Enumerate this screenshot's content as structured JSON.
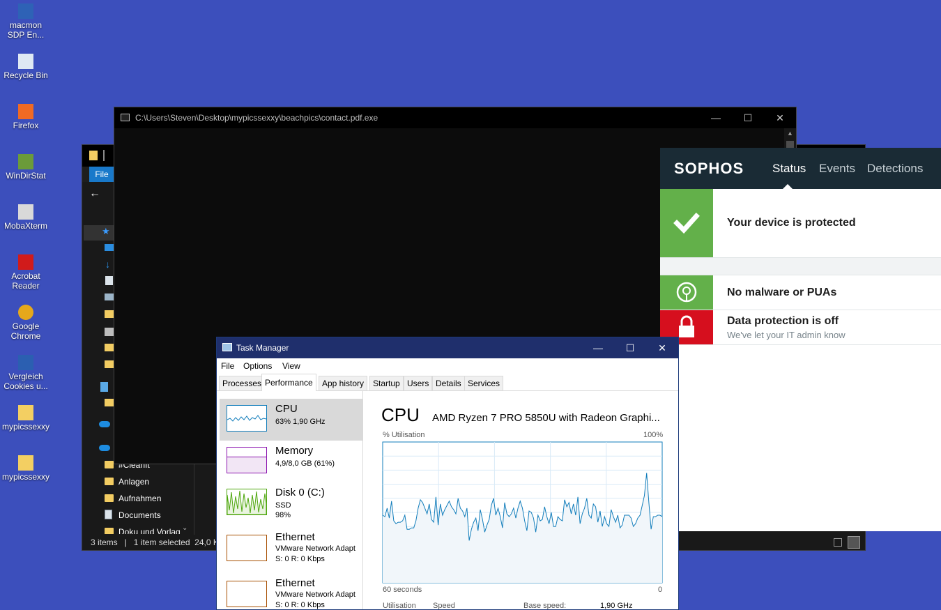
{
  "desktop_icons": [
    {
      "label": "macmon SDP En...",
      "icon": "macmon-icon"
    },
    {
      "label": "Recycle Bin",
      "icon": "recycle-bin-icon"
    },
    {
      "label": "Firefox",
      "icon": "firefox-icon"
    },
    {
      "label": "WinDirStat",
      "icon": "windirstat-icon"
    },
    {
      "label": "MobaXterm",
      "icon": "mobaxterm-icon"
    },
    {
      "label": "Acrobat Reader",
      "icon": "acrobat-icon"
    },
    {
      "label": "Google Chrome",
      "icon": "chrome-icon"
    },
    {
      "label": "Vergleich Cookies u...",
      "icon": "word-doc-icon"
    },
    {
      "label": "mypicssexxy",
      "icon": "zip-folder-icon"
    },
    {
      "label": "mypicssexxy",
      "icon": "folder-icon"
    }
  ],
  "explorer": {
    "file_tab": "File",
    "items": [
      "#CleanIt",
      "Anlagen",
      "Aufnahmen",
      "Documents",
      "Doku und Vorlag"
    ],
    "status": "3 items   |   1 item selected  24,0 K"
  },
  "cmd": {
    "title": "C:\\Users\\Steven\\Desktop\\mypicssexxy\\beachpics\\contact.pdf.exe"
  },
  "sophos": {
    "logo": "SOPHOS",
    "tabs": [
      "Status",
      "Events",
      "Detections"
    ],
    "status_main": "Your device is protected",
    "malware": "No malware or PUAs",
    "data_protection": "Data protection is off",
    "data_protection_sub": "We've let your IT admin know",
    "colors": {
      "green": "#63b04a",
      "red": "#d60f1e",
      "header": "#1a2b35"
    }
  },
  "task_manager": {
    "title": "Task Manager",
    "menu": [
      "File",
      "Options",
      "View"
    ],
    "tabs": [
      "Processes",
      "Performance",
      "App history",
      "Startup",
      "Users",
      "Details",
      "Services"
    ],
    "active_tab": "Performance",
    "left_items": [
      {
        "name": "CPU",
        "sub1": "63%  1,90 GHz",
        "sub2": ""
      },
      {
        "name": "Memory",
        "sub1": "4,9/8,0 GB (61%)",
        "sub2": ""
      },
      {
        "name": "Disk 0 (C:)",
        "sub1": "SSD",
        "sub2": "98%"
      },
      {
        "name": "Ethernet",
        "sub1": "VMware Network Adapt",
        "sub2": "S: 0  R: 0 Kbps"
      },
      {
        "name": "Ethernet",
        "sub1": "VMware Network Adapt",
        "sub2": "S: 0  R: 0 Kbps"
      }
    ],
    "cpu_title": "CPU",
    "cpu_model": "AMD Ryzen 7 PRO 5850U with Radeon Graphi...",
    "util_label": "% Utilisation",
    "util_max": "100%",
    "time_label": "60 seconds",
    "time_zero": "0",
    "bottom": {
      "utilisation": "Utilisation",
      "speed": "Speed",
      "base_speed_label": "Base speed:",
      "base_speed": "1,90 GHz"
    },
    "cpu_history": [
      48,
      47,
      53,
      46,
      58,
      44,
      42,
      43,
      43,
      44,
      48,
      38,
      38,
      39,
      39,
      44,
      53,
      59,
      57,
      53,
      49,
      56,
      45,
      43,
      61,
      41,
      56,
      48,
      52,
      55,
      58,
      54,
      52,
      49,
      60,
      53,
      51,
      47,
      53,
      30,
      38,
      43,
      46,
      37,
      52,
      45,
      36,
      41,
      45,
      55,
      60,
      48,
      53,
      47,
      39,
      57,
      49,
      47,
      49,
      53,
      46,
      53,
      58,
      53,
      44,
      37,
      51,
      50,
      46,
      36,
      48,
      44,
      45,
      54,
      47,
      42,
      50,
      40,
      40,
      47,
      45,
      44,
      59,
      54,
      57,
      49,
      56,
      48,
      61,
      42,
      49,
      53,
      60,
      48,
      46,
      56,
      54,
      43,
      51,
      40,
      47,
      42,
      40,
      52,
      47,
      43,
      48,
      39,
      41,
      48,
      48,
      48,
      46,
      40,
      42,
      46,
      48,
      55,
      62,
      78,
      57,
      38,
      47,
      47,
      48,
      48,
      47
    ]
  }
}
